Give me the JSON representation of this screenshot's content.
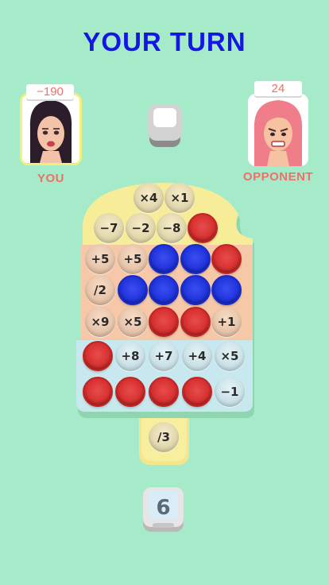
{
  "header": {
    "title": "YOUR TURN"
  },
  "players": {
    "you": {
      "score": "−190",
      "label": "YOU"
    },
    "opponent": {
      "score": "24",
      "label": "OPPONENT"
    }
  },
  "board": {
    "rows": [
      [
        {
          "text": "×4",
          "state": "empty"
        },
        {
          "text": "×1",
          "state": "empty"
        }
      ],
      [
        {
          "text": "−7",
          "state": "empty"
        },
        {
          "text": "−2",
          "state": "empty"
        },
        {
          "text": "−8",
          "state": "empty"
        },
        {
          "text": "",
          "state": "red"
        }
      ],
      [
        {
          "text": "+5",
          "state": "empty"
        },
        {
          "text": "+5",
          "state": "empty"
        },
        {
          "text": "",
          "state": "blue"
        },
        {
          "text": "",
          "state": "blue"
        },
        {
          "text": "",
          "state": "red"
        }
      ],
      [
        {
          "text": "/2",
          "state": "empty"
        },
        {
          "text": "",
          "state": "blue"
        },
        {
          "text": "",
          "state": "blue"
        },
        {
          "text": "",
          "state": "blue"
        },
        {
          "text": "",
          "state": "blue"
        }
      ],
      [
        {
          "text": "×9",
          "state": "empty"
        },
        {
          "text": "×5",
          "state": "empty"
        },
        {
          "text": "",
          "state": "red"
        },
        {
          "text": "",
          "state": "red"
        },
        {
          "text": "+1",
          "state": "empty"
        }
      ],
      [
        {
          "text": "",
          "state": "red"
        },
        {
          "text": "+8",
          "state": "empty"
        },
        {
          "text": "+7",
          "state": "empty"
        },
        {
          "text": "+4",
          "state": "empty"
        },
        {
          "text": "×5",
          "state": "empty"
        }
      ],
      [
        {
          "text": "",
          "state": "red"
        },
        {
          "text": "",
          "state": "red"
        },
        {
          "text": "",
          "state": "red"
        },
        {
          "text": "",
          "state": "red"
        },
        {
          "text": "−1",
          "state": "empty"
        }
      ]
    ],
    "stick": {
      "text": "/3"
    }
  },
  "dice": {
    "value": "6"
  },
  "colors": {
    "title": "#1416e3",
    "red": "#d62f2f",
    "blue": "#1f33dc",
    "yellow": "#f7ec98",
    "orange": "#f6c8a8",
    "lightblue": "#c8e8ef"
  }
}
